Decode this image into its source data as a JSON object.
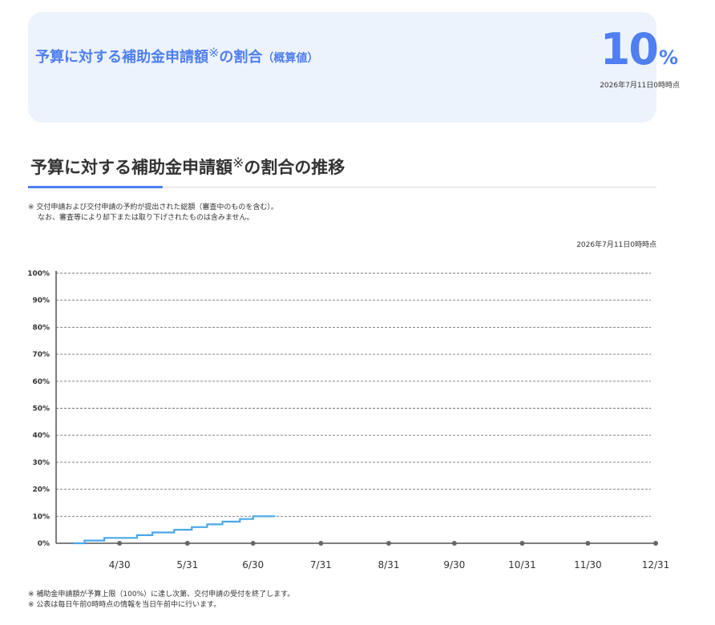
{
  "summary": {
    "title": "予算に対する補助金申請額",
    "mark": "※",
    "title_suffix": "の割合",
    "paren": "（概算値）",
    "value": "10",
    "unit": "%",
    "timestamp": "2026年7月11日0時時点"
  },
  "section": {
    "title": "予算に対する補助金申請額",
    "mark": "※",
    "title_suffix": "の割合の推移"
  },
  "note": {
    "line1": "※ 交付申請および交付申請の予約が提出された総額（審査中のものを含む）。",
    "line2": "なお、審査等により却下または取り下げされたものは含みません。"
  },
  "chart_timestamp": "2026年7月11日0時時点",
  "chart_data": {
    "type": "line",
    "line_style": "step",
    "series_color": "#4aa8ea",
    "grid": true,
    "x_ticks": [
      "4/30",
      "5/31",
      "6/30",
      "7/31",
      "8/31",
      "9/30",
      "10/31",
      "11/30",
      "12/31"
    ],
    "x_range": [
      "4/1",
      "12/31"
    ],
    "y_ticks": [
      "0%",
      "10%",
      "20%",
      "30%",
      "40%",
      "50%",
      "60%",
      "70%",
      "80%",
      "90%",
      "100%"
    ],
    "ylim": [
      0,
      100
    ],
    "points": [
      {
        "x": "4/9",
        "y": 0
      },
      {
        "x": "4/14",
        "y": 0
      },
      {
        "x": "4/14",
        "y": 1
      },
      {
        "x": "4/23",
        "y": 1
      },
      {
        "x": "4/23",
        "y": 2
      },
      {
        "x": "5/8",
        "y": 2
      },
      {
        "x": "5/8",
        "y": 3
      },
      {
        "x": "5/15",
        "y": 3
      },
      {
        "x": "5/15",
        "y": 4
      },
      {
        "x": "5/25",
        "y": 4
      },
      {
        "x": "5/25",
        "y": 5
      },
      {
        "x": "6/2",
        "y": 5
      },
      {
        "x": "6/2",
        "y": 6
      },
      {
        "x": "6/9",
        "y": 6
      },
      {
        "x": "6/9",
        "y": 7
      },
      {
        "x": "6/16",
        "y": 7
      },
      {
        "x": "6/16",
        "y": 8
      },
      {
        "x": "6/24",
        "y": 8
      },
      {
        "x": "6/24",
        "y": 9
      },
      {
        "x": "6/30",
        "y": 9
      },
      {
        "x": "6/30",
        "y": 10
      },
      {
        "x": "7/10",
        "y": 10
      }
    ]
  },
  "footnotes": [
    "※ 補助金申請額が予算上限（100%）に達し次第、交付申請の受付を終了します。",
    "※ 公表は毎日午前0時時点の情報を当日午前中に行います。"
  ]
}
